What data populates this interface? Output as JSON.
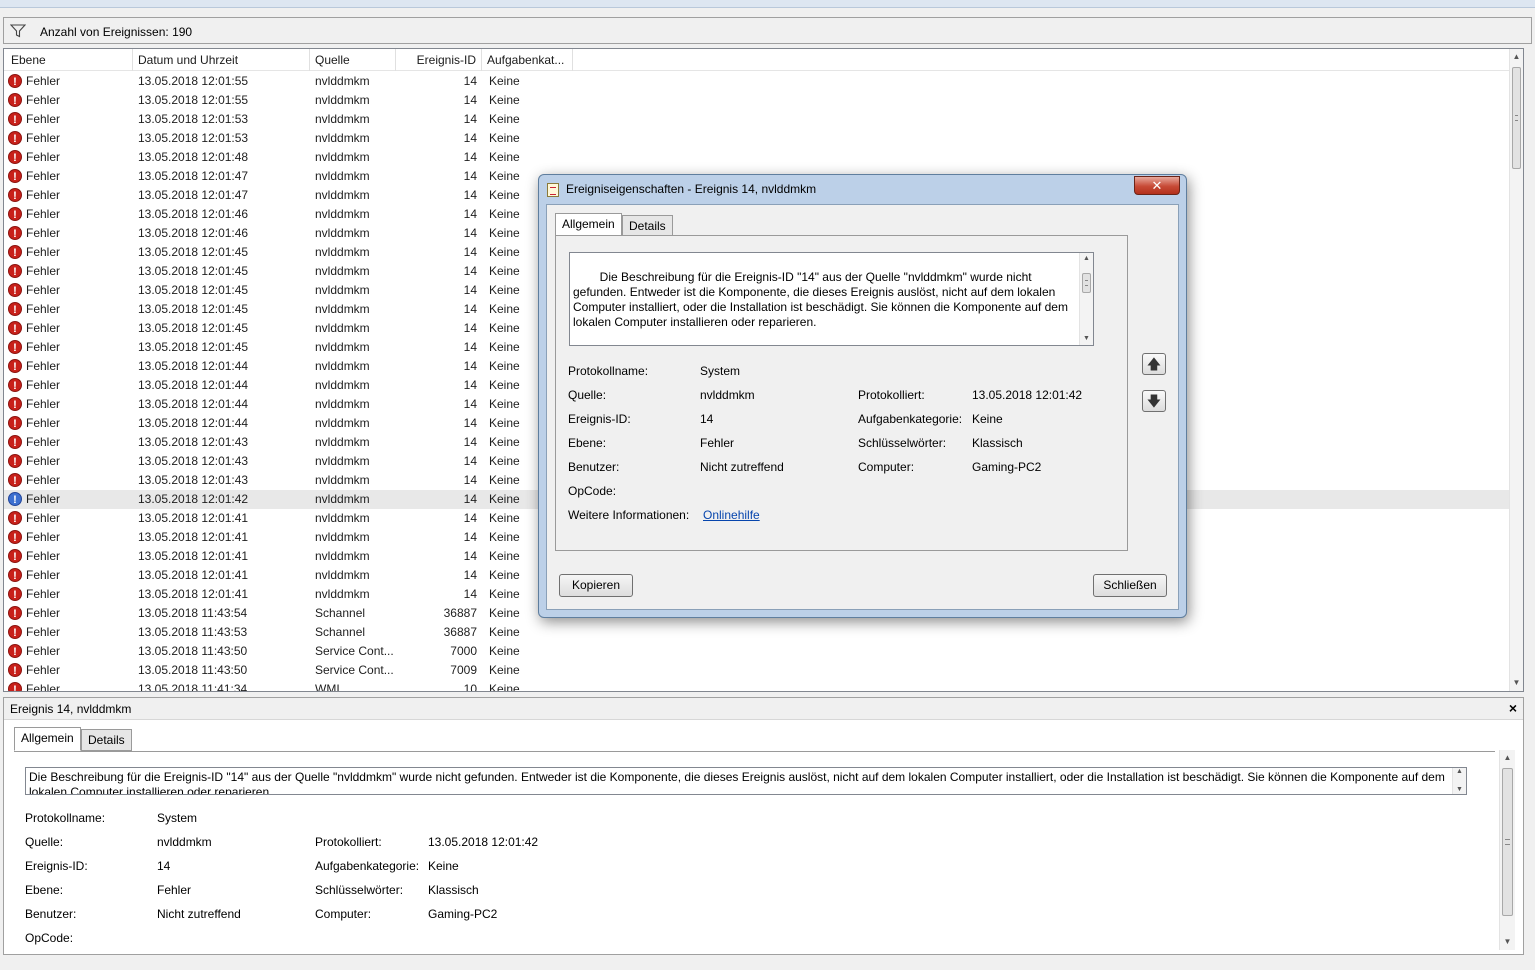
{
  "filter": {
    "count_text": "Anzahl von Ereignissen: 190"
  },
  "columns": [
    "Ebene",
    "Datum und Uhrzeit",
    "Quelle",
    "Ereignis-ID",
    "Aufgabenkat..."
  ],
  "events": [
    {
      "level": "Fehler",
      "date": "13.05.2018 12:01:55",
      "source": "nvlddmkm",
      "id": "14",
      "task": "Keine"
    },
    {
      "level": "Fehler",
      "date": "13.05.2018 12:01:55",
      "source": "nvlddmkm",
      "id": "14",
      "task": "Keine"
    },
    {
      "level": "Fehler",
      "date": "13.05.2018 12:01:53",
      "source": "nvlddmkm",
      "id": "14",
      "task": "Keine"
    },
    {
      "level": "Fehler",
      "date": "13.05.2018 12:01:53",
      "source": "nvlddmkm",
      "id": "14",
      "task": "Keine"
    },
    {
      "level": "Fehler",
      "date": "13.05.2018 12:01:48",
      "source": "nvlddmkm",
      "id": "14",
      "task": "Keine"
    },
    {
      "level": "Fehler",
      "date": "13.05.2018 12:01:47",
      "source": "nvlddmkm",
      "id": "14",
      "task": "Keine"
    },
    {
      "level": "Fehler",
      "date": "13.05.2018 12:01:47",
      "source": "nvlddmkm",
      "id": "14",
      "task": "Keine"
    },
    {
      "level": "Fehler",
      "date": "13.05.2018 12:01:46",
      "source": "nvlddmkm",
      "id": "14",
      "task": "Keine"
    },
    {
      "level": "Fehler",
      "date": "13.05.2018 12:01:46",
      "source": "nvlddmkm",
      "id": "14",
      "task": "Keine"
    },
    {
      "level": "Fehler",
      "date": "13.05.2018 12:01:45",
      "source": "nvlddmkm",
      "id": "14",
      "task": "Keine"
    },
    {
      "level": "Fehler",
      "date": "13.05.2018 12:01:45",
      "source": "nvlddmkm",
      "id": "14",
      "task": "Keine"
    },
    {
      "level": "Fehler",
      "date": "13.05.2018 12:01:45",
      "source": "nvlddmkm",
      "id": "14",
      "task": "Keine"
    },
    {
      "level": "Fehler",
      "date": "13.05.2018 12:01:45",
      "source": "nvlddmkm",
      "id": "14",
      "task": "Keine"
    },
    {
      "level": "Fehler",
      "date": "13.05.2018 12:01:45",
      "source": "nvlddmkm",
      "id": "14",
      "task": "Keine"
    },
    {
      "level": "Fehler",
      "date": "13.05.2018 12:01:45",
      "source": "nvlddmkm",
      "id": "14",
      "task": "Keine"
    },
    {
      "level": "Fehler",
      "date": "13.05.2018 12:01:44",
      "source": "nvlddmkm",
      "id": "14",
      "task": "Keine"
    },
    {
      "level": "Fehler",
      "date": "13.05.2018 12:01:44",
      "source": "nvlddmkm",
      "id": "14",
      "task": "Keine"
    },
    {
      "level": "Fehler",
      "date": "13.05.2018 12:01:44",
      "source": "nvlddmkm",
      "id": "14",
      "task": "Keine"
    },
    {
      "level": "Fehler",
      "date": "13.05.2018 12:01:44",
      "source": "nvlddmkm",
      "id": "14",
      "task": "Keine"
    },
    {
      "level": "Fehler",
      "date": "13.05.2018 12:01:43",
      "source": "nvlddmkm",
      "id": "14",
      "task": "Keine"
    },
    {
      "level": "Fehler",
      "date": "13.05.2018 12:01:43",
      "source": "nvlddmkm",
      "id": "14",
      "task": "Keine"
    },
    {
      "level": "Fehler",
      "date": "13.05.2018 12:01:43",
      "source": "nvlddmkm",
      "id": "14",
      "task": "Keine"
    },
    {
      "level": "Fehler",
      "date": "13.05.2018 12:01:42",
      "source": "nvlddmkm",
      "id": "14",
      "task": "Keine",
      "selected": true
    },
    {
      "level": "Fehler",
      "date": "13.05.2018 12:01:41",
      "source": "nvlddmkm",
      "id": "14",
      "task": "Keine"
    },
    {
      "level": "Fehler",
      "date": "13.05.2018 12:01:41",
      "source": "nvlddmkm",
      "id": "14",
      "task": "Keine"
    },
    {
      "level": "Fehler",
      "date": "13.05.2018 12:01:41",
      "source": "nvlddmkm",
      "id": "14",
      "task": "Keine"
    },
    {
      "level": "Fehler",
      "date": "13.05.2018 12:01:41",
      "source": "nvlddmkm",
      "id": "14",
      "task": "Keine"
    },
    {
      "level": "Fehler",
      "date": "13.05.2018 12:01:41",
      "source": "nvlddmkm",
      "id": "14",
      "task": "Keine"
    },
    {
      "level": "Fehler",
      "date": "13.05.2018 11:43:54",
      "source": "Schannel",
      "id": "36887",
      "task": "Keine"
    },
    {
      "level": "Fehler",
      "date": "13.05.2018 11:43:53",
      "source": "Schannel",
      "id": "36887",
      "task": "Keine"
    },
    {
      "level": "Fehler",
      "date": "13.05.2018 11:43:50",
      "source": "Service Cont...",
      "id": "7000",
      "task": "Keine"
    },
    {
      "level": "Fehler",
      "date": "13.05.2018 11:43:50",
      "source": "Service Cont...",
      "id": "7009",
      "task": "Keine"
    },
    {
      "level": "Fehler",
      "date": "13.05.2018 11:41:34",
      "source": "WMI",
      "id": "10",
      "task": "Keine"
    }
  ],
  "preview": {
    "title": "Ereignis 14, nvlddmkm",
    "close": "×",
    "tabs": [
      "Allgemein",
      "Details"
    ],
    "description": "Die Beschreibung für die Ereignis-ID \"14\" aus der Quelle \"nvlddmkm\" wurde nicht gefunden. Entweder ist die Komponente, die dieses Ereignis auslöst, nicht auf dem lokalen Computer installiert, oder die Installation ist beschädigt. Sie können die Komponente auf dem lokalen Computer installieren oder reparieren."
  },
  "fields": {
    "log_label": "Protokollname:",
    "log_value": "System",
    "source_label": "Quelle:",
    "source_value": "nvlddmkm",
    "logged_label": "Protokolliert:",
    "logged_value": "13.05.2018 12:01:42",
    "id_label": "Ereignis-ID:",
    "id_value": "14",
    "task_label": "Aufgabenkategorie:",
    "task_value": "Keine",
    "level_label": "Ebene:",
    "level_value": "Fehler",
    "keywords_label": "Schlüsselwörter:",
    "keywords_value": "Klassisch",
    "user_label": "Benutzer:",
    "user_value": "Nicht zutreffend",
    "computer_label": "Computer:",
    "computer_value": "Gaming-PC2",
    "opcode_label": "OpCode:",
    "more_label": "Weitere Informationen:",
    "more_link": "Onlinehilfe"
  },
  "dialog": {
    "title": "Ereigniseigenschaften - Ereignis 14, nvlddmkm",
    "close": "✕",
    "tabs": [
      "Allgemein",
      "Details"
    ],
    "description": "Die Beschreibung für die Ereignis-ID \"14\" aus der Quelle \"nvlddmkm\" wurde nicht gefunden. Entweder ist die Komponente, die dieses Ereignis auslöst, nicht auf dem lokalen Computer installiert, oder die Installation ist beschädigt. Sie können die Komponente auf dem lokalen Computer installieren oder reparieren.\n\nFalls das Ereignis auf einem anderen Computer aufgetreten ist, mussten die",
    "copy_button": "Kopieren",
    "close_button": "Schließen",
    "up_arrow": "🡅",
    "down_arrow": "🡇"
  },
  "icons": {
    "error": "!",
    "scroll_up": "▲",
    "scroll_down": "▼"
  },
  "colors": {
    "error": "#c8201a",
    "link": "#0645ad",
    "selection": "#e8e8e8",
    "dialog_frame": "#bcd0e8"
  }
}
